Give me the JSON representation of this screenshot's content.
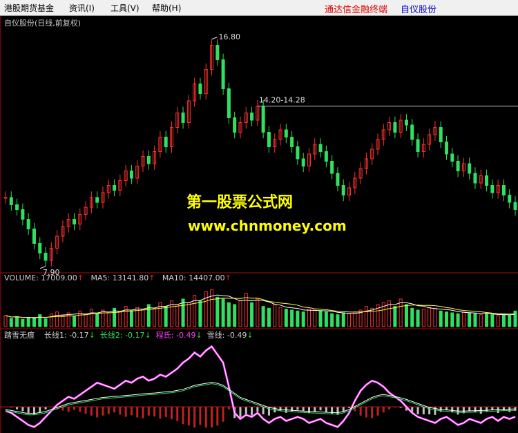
{
  "menu": {
    "item1": "港股期货基金",
    "item2": "资讯(I)",
    "item3": "工具(V)",
    "item4": "帮助(H)",
    "brand": "通达信金融终端",
    "stock": "自仪股份"
  },
  "main_chart": {
    "title": "自仪股份(日线,前复权)",
    "high_label": "16.80",
    "low_label": "7.90",
    "range_label": "14.20-14.28"
  },
  "volume": {
    "label": "VOLUME: 17009.00",
    "ma5": "MA5: 13141.80",
    "ma10": "MA10: 14407.00",
    "arrow_up": "↑"
  },
  "indicator": {
    "name": "踏雪无痕",
    "l1": "长线1: -0.17",
    "l2": "长线2: -0.17",
    "l3": "程氏: -0.49",
    "l4": "雪线: -0.49",
    "arrow_dn": "↓"
  },
  "watermark": {
    "line1": "第一股票公式网",
    "line2": "www.chnmoney.com"
  },
  "colors": {
    "up": "#ff3030",
    "down": "#30e060",
    "frame": "#a01010",
    "menu_brand": "#e00000",
    "menu_stock": "#0000cc",
    "watermark": "#ffff00"
  },
  "chart_data": {
    "type": "line",
    "price_series": {
      "name": "close",
      "values": [
        10.5,
        10.2,
        10.0,
        9.6,
        9.2,
        8.6,
        8.2,
        7.9,
        8.4,
        8.9,
        9.3,
        9.6,
        9.4,
        9.8,
        10.1,
        10.5,
        10.3,
        10.7,
        11.0,
        10.8,
        11.2,
        11.6,
        11.3,
        11.8,
        12.2,
        11.9,
        12.4,
        13.0,
        12.6,
        13.4,
        14.0,
        13.6,
        14.5,
        15.2,
        14.8,
        15.8,
        16.8,
        16.2,
        15.0,
        13.8,
        13.2,
        13.6,
        14.0,
        13.7,
        14.28,
        13.2,
        12.6,
        12.9,
        13.3,
        13.0,
        12.6,
        12.1,
        11.8,
        12.3,
        12.7,
        12.4,
        12.0,
        11.5,
        11.0,
        10.6,
        10.9,
        11.3,
        11.7,
        12.1,
        12.5,
        12.9,
        13.3,
        13.6,
        13.2,
        13.7,
        13.5,
        12.9,
        12.4,
        12.7,
        13.1,
        13.4,
        12.8,
        12.3,
        12.0,
        11.6,
        11.9,
        11.5,
        11.1,
        11.4,
        11.0,
        10.7,
        11.0,
        10.6,
        10.3,
        10.0
      ],
      "ylim": [
        7.5,
        17.5
      ]
    },
    "volume_series": {
      "name": "VOLUME",
      "values": [
        12000,
        9000,
        11000,
        8000,
        10000,
        9500,
        13000,
        8500,
        14000,
        16000,
        12000,
        15000,
        11000,
        17000,
        13000,
        19000,
        14000,
        18000,
        15000,
        20000,
        16000,
        22000,
        17000,
        21000,
        19000,
        24000,
        20000,
        26000,
        22000,
        28000,
        24000,
        30000,
        26000,
        34000,
        28000,
        38000,
        40000,
        32000,
        30000,
        26000,
        24000,
        28000,
        36000,
        26000,
        30000,
        22000,
        20000,
        24000,
        21000,
        19000,
        18000,
        17000,
        16000,
        19000,
        18000,
        17000,
        16000,
        14000,
        13000,
        15000,
        14000,
        16000,
        18000,
        22000,
        20000,
        24000,
        26000,
        28000,
        22000,
        30000,
        24000,
        20000,
        18000,
        19000,
        21000,
        20000,
        17000,
        16000,
        15000,
        14000,
        16000,
        15000,
        14000,
        13000,
        14000,
        13000,
        12000,
        13000,
        12000,
        17009
      ],
      "ylim": [
        0,
        45000
      ]
    },
    "indicator_series": [
      {
        "name": "程氏",
        "values": [
          -0.2,
          -0.3,
          -0.5,
          -0.7,
          -0.9,
          -1.0,
          -0.8,
          -0.5,
          -0.2,
          0.1,
          0.3,
          0.5,
          0.4,
          0.6,
          0.8,
          1.0,
          1.2,
          1.1,
          1.0,
          0.9,
          1.1,
          1.3,
          1.2,
          1.4,
          1.5,
          1.3,
          1.4,
          1.6,
          1.5,
          1.7,
          1.9,
          2.2,
          2.4,
          2.7,
          2.5,
          2.8,
          3.0,
          2.6,
          2.2,
          1.0,
          -0.3,
          -0.6,
          -0.4,
          -0.5,
          -0.3,
          -0.6,
          -0.8,
          -0.6,
          -0.5,
          -0.7,
          -0.6,
          -0.5,
          -0.6,
          -0.8,
          -0.7,
          -0.6,
          -0.8,
          -0.9,
          -1.0,
          -0.7,
          -0.3,
          0.3,
          0.8,
          1.1,
          1.3,
          1.2,
          1.0,
          0.7,
          0.5,
          0.3,
          0.0,
          -0.3,
          -0.5,
          -0.6,
          -0.7,
          -0.8,
          -0.6,
          -0.5,
          -0.7,
          -0.9,
          -0.8,
          -0.6,
          -0.7,
          -0.8,
          -0.6,
          -0.5,
          -0.7,
          -0.5,
          -0.6,
          -0.49
        ]
      },
      {
        "name": "长线1",
        "values": [
          -0.2,
          -0.25,
          -0.3,
          -0.35,
          -0.4,
          -0.4,
          -0.35,
          -0.3,
          -0.2,
          -0.1,
          0.0,
          0.1,
          0.15,
          0.2,
          0.25,
          0.3,
          0.35,
          0.4,
          0.42,
          0.45,
          0.47,
          0.5,
          0.52,
          0.55,
          0.58,
          0.6,
          0.62,
          0.65,
          0.68,
          0.7,
          0.75,
          0.8,
          0.9,
          1.0,
          1.05,
          1.1,
          1.15,
          1.1,
          1.0,
          0.8,
          0.6,
          0.4,
          0.3,
          0.2,
          0.1,
          0.0,
          -0.1,
          -0.15,
          -0.2,
          -0.22,
          -0.24,
          -0.26,
          -0.28,
          -0.3,
          -0.31,
          -0.32,
          -0.34,
          -0.35,
          -0.36,
          -0.3,
          -0.2,
          -0.05,
          0.1,
          0.25,
          0.4,
          0.5,
          0.55,
          0.5,
          0.45,
          0.38,
          0.3,
          0.2,
          0.1,
          0.0,
          -0.1,
          -0.15,
          -0.2,
          -0.22,
          -0.25,
          -0.28,
          -0.28,
          -0.27,
          -0.26,
          -0.25,
          -0.24,
          -0.22,
          -0.2,
          -0.19,
          -0.18,
          -0.17
        ]
      }
    ]
  }
}
